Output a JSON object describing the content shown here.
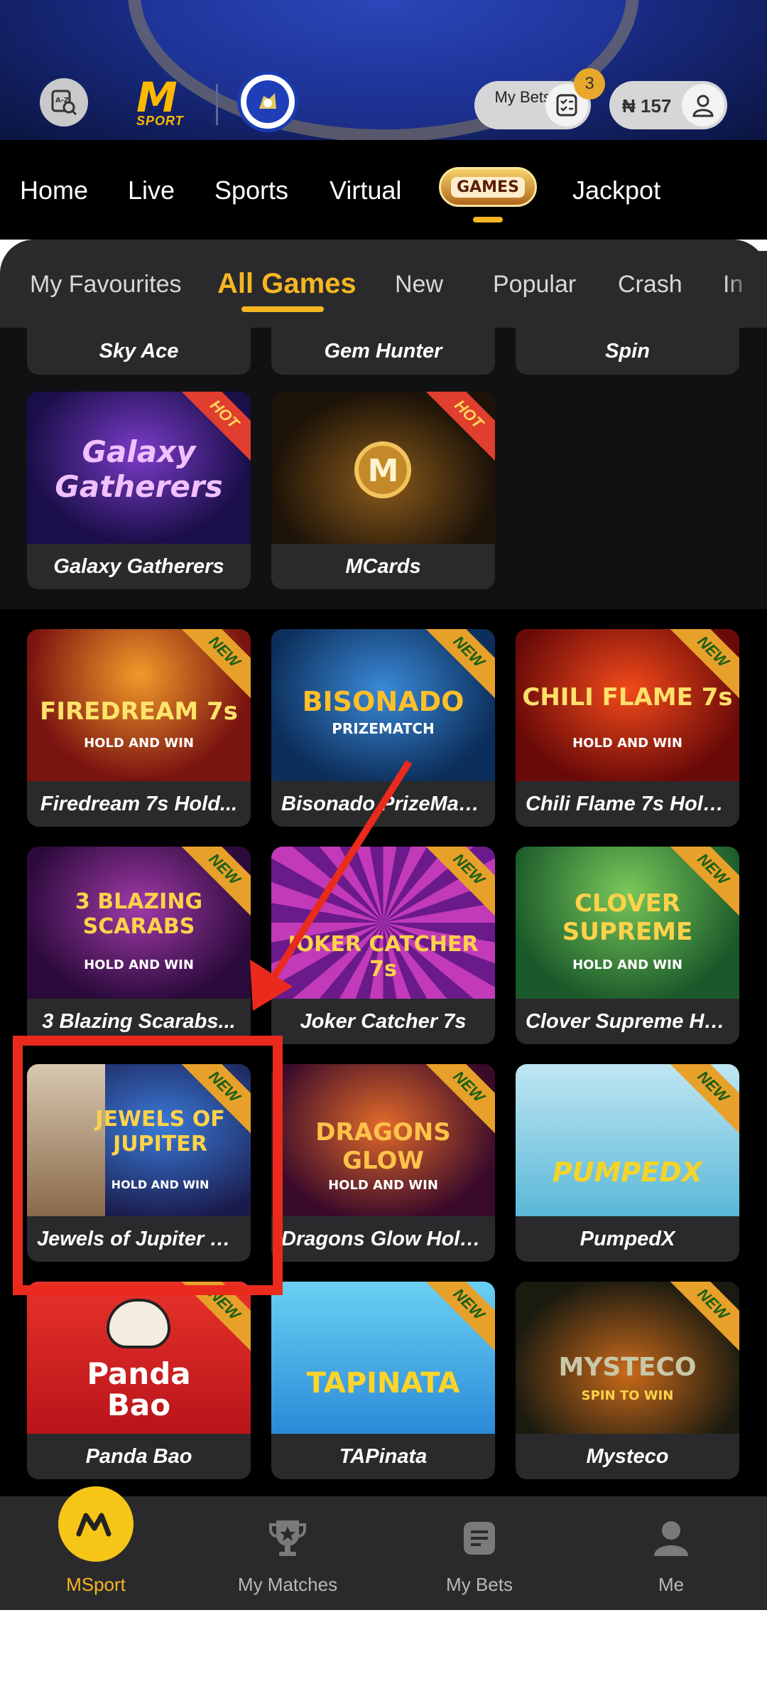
{
  "header": {
    "logo_text": "M",
    "logo_sub": "SPORT",
    "my_bets_label": "My Bets",
    "bets_count": "3",
    "balance": "₦ 157"
  },
  "nav": {
    "items": [
      "Home",
      "Live",
      "Sports",
      "Virtual",
      "Jackpot"
    ],
    "games_badge": "GAMES"
  },
  "categories": {
    "items": [
      "My Favourites",
      "All Games",
      "New",
      "Popular",
      "Crash",
      "In"
    ],
    "active": "All Games"
  },
  "partial_row": [
    "Sky Ace",
    "Gem Hunter",
    "Spin"
  ],
  "hot_games": [
    {
      "title": "Galaxy Gatherers",
      "image_text": "Galaxy Gatherers",
      "badge": "HOT"
    },
    {
      "title": "MCards",
      "image_text": "M",
      "badge": "HOT"
    }
  ],
  "new_games": [
    {
      "title": "Firedream 7s Hold...",
      "image_text": "FIREDREAM 7s",
      "sub": "HOLD AND WIN",
      "badge": "NEW"
    },
    {
      "title": "Bisonado PrizeMatc...",
      "image_text": "BISONADO",
      "sub": "PRIZEMATCH",
      "badge": "NEW"
    },
    {
      "title": "Chili Flame 7s Hold...",
      "image_text": "CHILI FLAME 7s",
      "sub": "HOLD AND WIN",
      "badge": "NEW"
    },
    {
      "title": "3 Blazing Scarabs...",
      "image_text": "3 BLAZING SCARABS",
      "sub": "HOLD AND WIN",
      "badge": "NEW"
    },
    {
      "title": "Joker Catcher 7s",
      "image_text": "JOKER CATCHER 7s",
      "sub": "",
      "badge": "NEW"
    },
    {
      "title": "Clover Supreme Hol...",
      "image_text": "CLOVER SUPREME",
      "sub": "HOLD AND WIN",
      "badge": "NEW"
    },
    {
      "title": "Jewels of Jupiter H...",
      "image_text": "JEWELS OF JUPITER",
      "sub": "HOLD AND WIN",
      "badge": "NEW"
    },
    {
      "title": "Dragons Glow Hold...",
      "image_text": "DRAGONS GLOW",
      "sub": "HOLD AND WIN",
      "badge": "NEW"
    },
    {
      "title": "PumpedX",
      "image_text": "PUMPEDX",
      "sub": "",
      "badge": "NEW"
    },
    {
      "title": "Panda Bao",
      "image_text": "Panda Bao",
      "sub": "",
      "badge": "NEW"
    },
    {
      "title": "TAPinata",
      "image_text": "TAPINATA",
      "sub": "",
      "badge": "NEW"
    },
    {
      "title": "Mysteco",
      "image_text": "MYSTECO",
      "sub": "SPIN TO WIN",
      "badge": "NEW"
    }
  ],
  "bottom_nav": {
    "items": [
      "MSport",
      "My Matches",
      "My Bets",
      "Me"
    ],
    "active": "MSport"
  },
  "colors": {
    "accent": "#f5b622",
    "highlight": "#ea2a1c",
    "card_bg": "#2a2a2c",
    "header_blue": "#1a2c86"
  }
}
